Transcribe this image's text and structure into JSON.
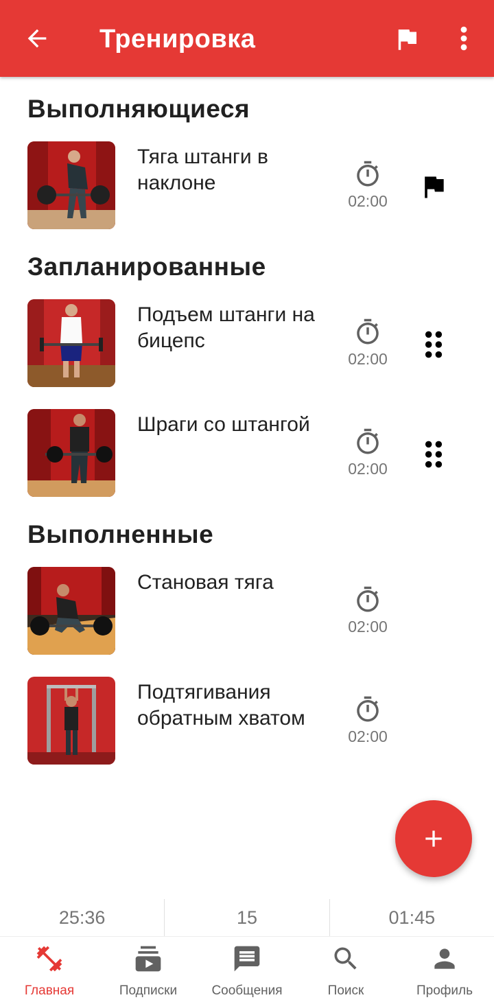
{
  "appbar": {
    "title": "Тренировка"
  },
  "sections": {
    "in_progress": "Выполняющиеся",
    "planned": "Запланированные",
    "completed": "Выполненные"
  },
  "exercises": [
    {
      "name": "Тяга штанги в наклоне",
      "time": "02:00"
    },
    {
      "name": "Подъем штанги на бицепс",
      "time": "02:00"
    },
    {
      "name": "Шраги со штангой",
      "time": "02:00"
    },
    {
      "name": "Становая тяга",
      "time": "02:00"
    },
    {
      "name": "Подтягивания обратным хватом",
      "time": "02:00"
    }
  ],
  "stats": {
    "total_time": "25:36",
    "count": "15",
    "rest_time": "01:45"
  },
  "nav": [
    {
      "label": "Главная",
      "icon": "dumbbell-icon",
      "active": true
    },
    {
      "label": "Подписки",
      "icon": "subscriptions-icon",
      "active": false
    },
    {
      "label": "Сообщения",
      "icon": "message-icon",
      "active": false
    },
    {
      "label": "Поиск",
      "icon": "search-icon",
      "active": false
    },
    {
      "label": "Профиль",
      "icon": "person-icon",
      "active": false
    }
  ],
  "colors": {
    "accent": "#e53935",
    "text_primary": "#212121",
    "text_secondary": "#757575"
  }
}
